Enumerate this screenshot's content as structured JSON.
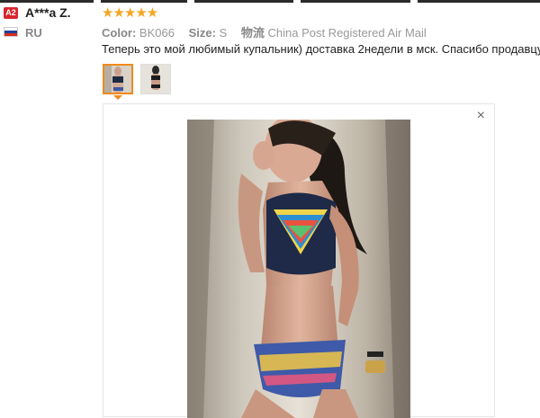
{
  "reviewer": {
    "badge": "A2",
    "name": "A***a Z.",
    "country": "RU",
    "flag_colors": [
      "#ffffff",
      "#1c3f9a",
      "#d52b1e"
    ]
  },
  "review": {
    "rating": "★★★★★",
    "color_label": "Color:",
    "color_value": "BK066",
    "size_label": "Size:",
    "size_value": "S",
    "shipping_label": "物流",
    "shipping_value": "China Post Registered Air Mail",
    "text": "Теперь это мой любимый купальник) доставка 2недели в мск. Спасибо продавцу□□"
  },
  "viewer": {
    "close_label": "×"
  },
  "colors": {
    "star": "#f5a623",
    "selected_border": "#f08a1e",
    "badge": "#d9262d"
  }
}
